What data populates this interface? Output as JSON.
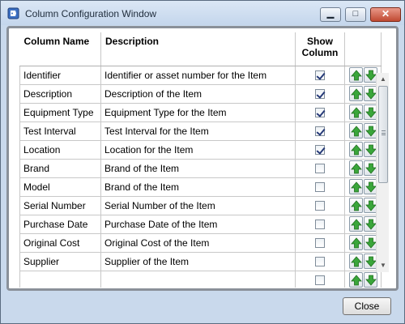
{
  "window": {
    "title": "Column Configuration Window",
    "icon": "tag-icon",
    "min_glyph": "▁",
    "max_glyph": "□",
    "close_glyph": "✕"
  },
  "table": {
    "headers": {
      "name": "Column Name",
      "description": "Description",
      "show": "Show Column"
    },
    "rows": [
      {
        "name": "Identifier",
        "description": "Identifier or asset number for the Item",
        "show": true
      },
      {
        "name": "Description",
        "description": "Description of the Item",
        "show": true
      },
      {
        "name": "Equipment Type",
        "description": "Equipment Type for the Item",
        "show": true
      },
      {
        "name": "Test Interval",
        "description": "Test Interval for the Item",
        "show": true
      },
      {
        "name": "Location",
        "description": "Location for the Item",
        "show": true
      },
      {
        "name": "Brand",
        "description": "Brand of the Item",
        "show": false
      },
      {
        "name": "Model",
        "description": "Brand of the Item",
        "show": false
      },
      {
        "name": "Serial Number",
        "description": "Serial Number of the Item",
        "show": false
      },
      {
        "name": "Purchase Date",
        "description": "Purchase Date of the Item",
        "show": false
      },
      {
        "name": "Original Cost",
        "description": "Original Cost of the Item",
        "show": false
      },
      {
        "name": "Supplier",
        "description": "Supplier of the Item",
        "show": false
      },
      {
        "name": "",
        "description": "",
        "show": false
      }
    ]
  },
  "icons": {
    "move_up": "green-up-arrow-icon",
    "move_down": "green-down-arrow-icon"
  },
  "colors": {
    "arrow_green": "#3aa63a",
    "arrow_green_dark": "#1f6e1f",
    "checkmark": "#263a78"
  },
  "scrollbar": {
    "up": "▲",
    "down": "▼"
  },
  "footer": {
    "close_label": "Close"
  }
}
